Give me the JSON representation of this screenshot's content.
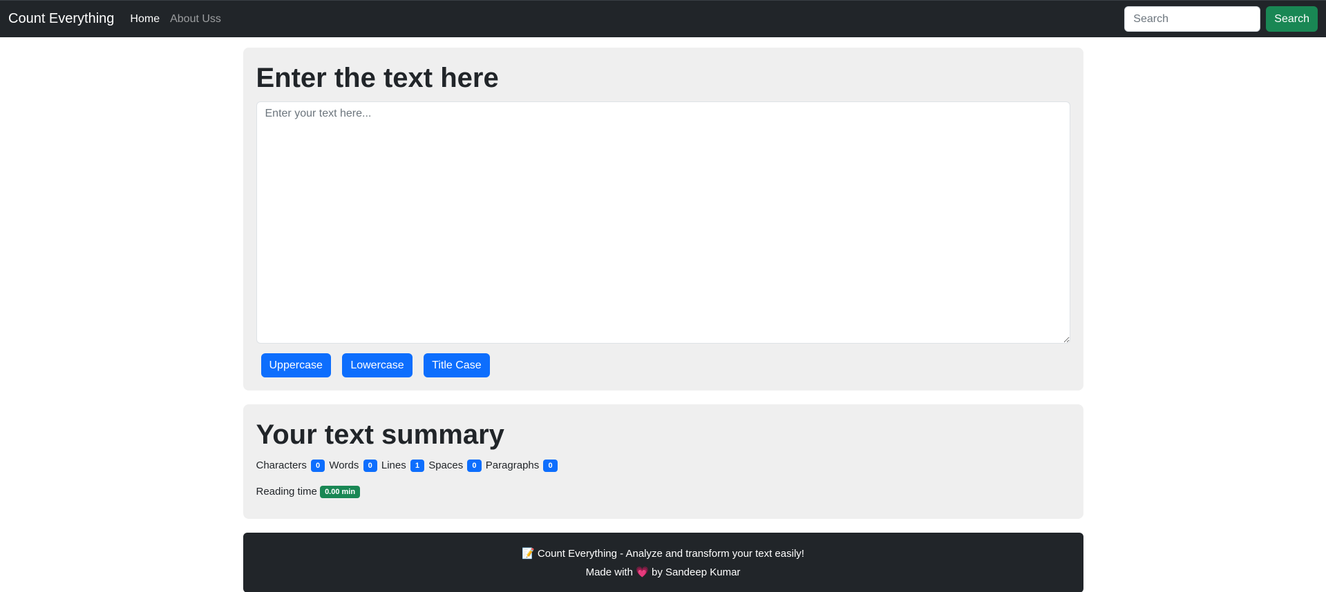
{
  "navbar": {
    "brand": "Count Everything",
    "links": [
      {
        "label": "Home",
        "active": true
      },
      {
        "label": "About Uss",
        "active": false
      }
    ],
    "search": {
      "placeholder": "Search",
      "button_label": "Search"
    }
  },
  "editor": {
    "title": "Enter the text here",
    "placeholder": "Enter your text here...",
    "buttons": [
      "Uppercase",
      "Lowercase",
      "Title Case"
    ]
  },
  "summary": {
    "title": "Your text summary",
    "stats": [
      {
        "label": "Characters",
        "value": "0"
      },
      {
        "label": "Words",
        "value": "0"
      },
      {
        "label": "Lines",
        "value": "1"
      },
      {
        "label": "Spaces",
        "value": "0"
      },
      {
        "label": "Paragraphs",
        "value": "0"
      }
    ],
    "reading_label": "Reading time",
    "reading_value": "0.00 min"
  },
  "footer": {
    "line1_icon": "📝",
    "line1_text": "Count Everything - Analyze and transform your text easily!",
    "line2_prefix": "Made with",
    "line2_heart": "💗",
    "line2_suffix": "by Sandeep Kumar"
  },
  "colors": {
    "navbar_bg": "#212529",
    "primary": "#0d6efd",
    "success": "#198754",
    "card_bg": "#efefef"
  }
}
